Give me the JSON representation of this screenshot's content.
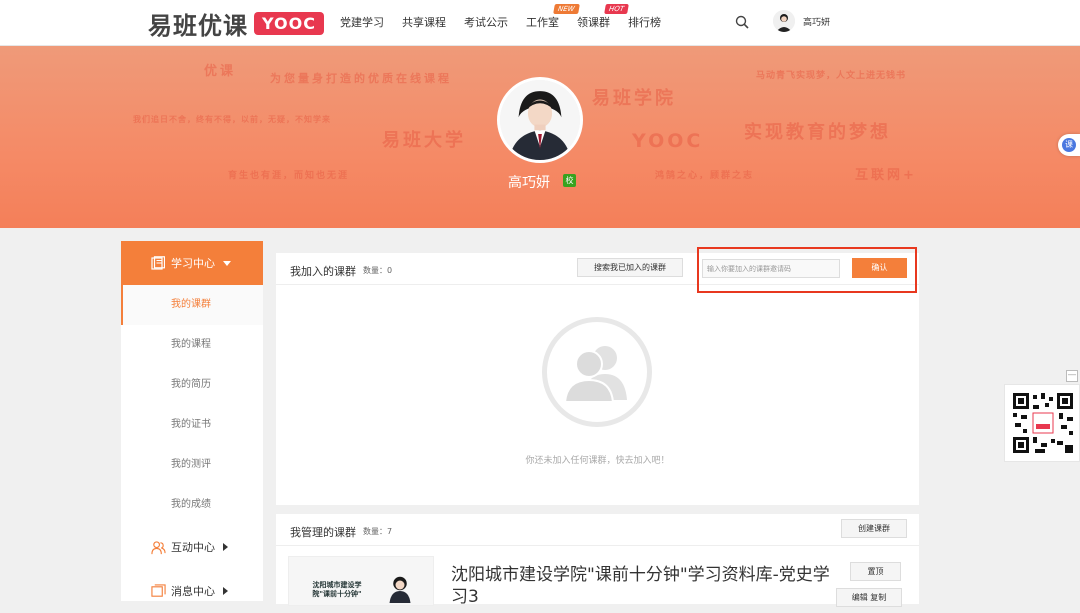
{
  "header": {
    "logo_cn": "易班优课",
    "logo_en": "YOOC",
    "nav": [
      {
        "label": "党建学习"
      },
      {
        "label": "共享课程"
      },
      {
        "label": "考试公示"
      },
      {
        "label": "工作室",
        "badge": "NEW"
      },
      {
        "label": "领课群",
        "badge": "HOT"
      },
      {
        "label": "排行榜"
      }
    ],
    "user_name": "高巧妍"
  },
  "banner": {
    "user_name": "高巧妍",
    "school_badge": "校",
    "words": [
      "优课",
      "为您量身打造的优质在线课程",
      "马动青飞实现梦，人文上进无钱书",
      "易班学院",
      "我们追日不舍，终有不得，以前，无疑，不知学来",
      "易班大学",
      "YOOC",
      "实现教育的梦想",
      "育生也有涯，而知也无涯",
      "鸿鹄之心，顾群之志",
      "互联网+"
    ]
  },
  "float_tab_label": "课",
  "sidebar": {
    "head": "学习中心",
    "items": [
      "我的课群",
      "我的课程",
      "我的简历",
      "我的证书",
      "我的测评",
      "我的成绩"
    ],
    "groups": [
      "互动中心",
      "消息中心"
    ]
  },
  "joined": {
    "title": "我加入的课群",
    "count": "数量：0",
    "search_button": "搜索我已加入的课群",
    "invite_placeholder": "输入你要加入的课群邀请码",
    "confirm_button": "确认",
    "empty_text": "你还未加入任何课群，快去加入吧！"
  },
  "managed": {
    "title": "我管理的课群",
    "count": "数量：7",
    "create_button": "创建课群",
    "course": {
      "thumb_text": "沈阳城市建设学院\"课前十分钟\"",
      "title": "沈阳城市建设学院\"课前十分钟\"学习资料库-党史学习3",
      "top_button": "置顶",
      "second_button": "编辑 复制"
    }
  },
  "colors": {
    "accent": "#f47f3a",
    "highlight": "#e8381f",
    "banner": "#f58a66"
  }
}
